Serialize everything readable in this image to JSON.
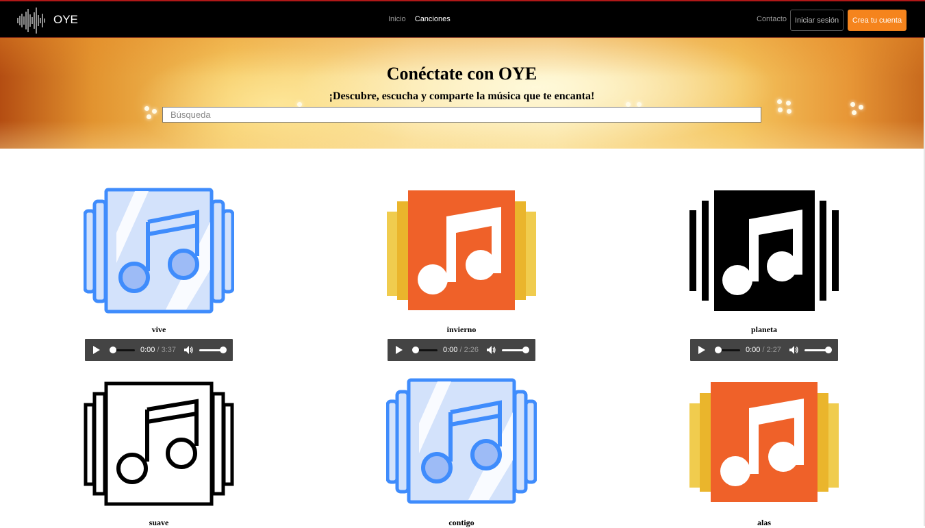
{
  "header": {
    "brand": "OYE",
    "nav": {
      "inicio": "Inicio",
      "canciones": "Canciones"
    },
    "contacto": "Contacto",
    "login": "Iniciar sesión",
    "signup": "Crea tu cuenta"
  },
  "hero": {
    "title": "Conéctate con OYE",
    "subtitle": "¡Descubre, escucha y comparte la música que te encanta!",
    "search_placeholder": "Búsqueda"
  },
  "songs": [
    {
      "title": "vive",
      "cover": "music-album-icon",
      "style": "blue",
      "current": "0:00",
      "duration": "/ 3:37",
      "progress": 0,
      "volume": 1.0
    },
    {
      "title": "invierno",
      "cover": "music-album-icon",
      "style": "orange",
      "current": "0:00",
      "duration": "/ 2:26",
      "progress": 0,
      "volume": 1.0
    },
    {
      "title": "planeta",
      "cover": "music-album-icon",
      "style": "black",
      "current": "0:00",
      "duration": "/ 2:27",
      "progress": 0,
      "volume": 1.0
    },
    {
      "title": "suave",
      "cover": "music-album-icon",
      "style": "outline"
    },
    {
      "title": "contigo",
      "cover": "music-album-icon",
      "style": "blue"
    },
    {
      "title": "alas",
      "cover": "music-album-icon",
      "style": "orange"
    }
  ],
  "colors": {
    "accent": "#f5841d",
    "navbar": "#000000",
    "blue_icon": "#3f8cfc",
    "orange_icon": "#ef6129",
    "yellow_icon": "#eab52c"
  }
}
